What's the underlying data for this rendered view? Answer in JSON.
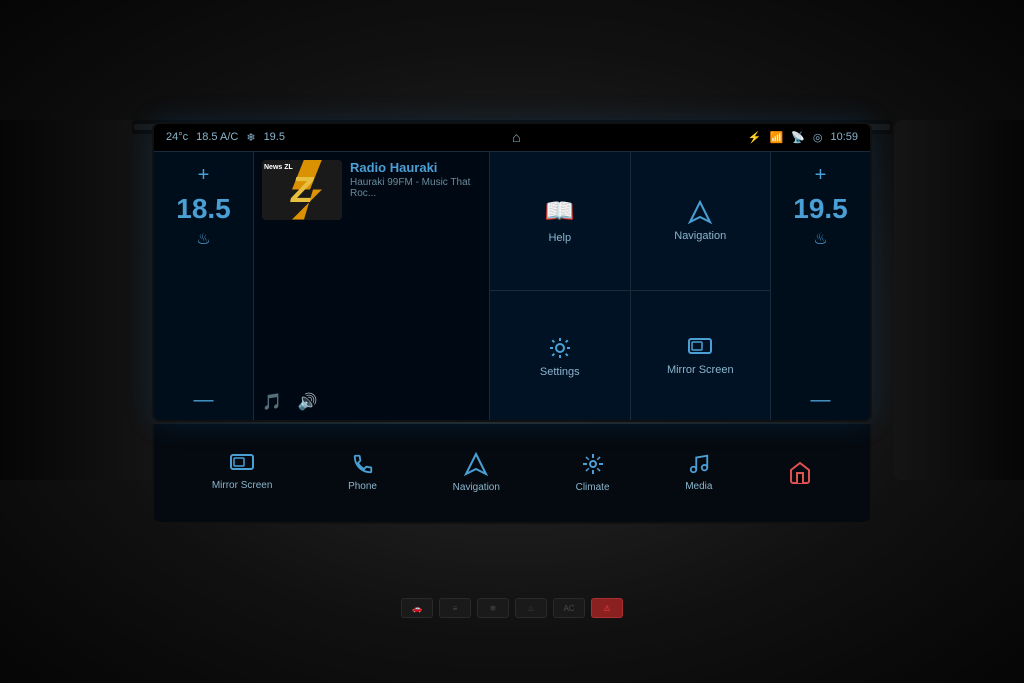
{
  "statusBar": {
    "tempLeft": "24°c",
    "acTemp": "18.5 A/C",
    "fanSpeed": "19.5",
    "time": "10:59",
    "homeIcon": "⌂"
  },
  "climateLeft": {
    "plusLabel": "+",
    "temperature": "18.5",
    "seatIcon": "♨",
    "minusLabel": "—"
  },
  "climateRight": {
    "plusLabel": "+",
    "temperature": "19.5",
    "seatIcon": "♨",
    "minusLabel": "—"
  },
  "media": {
    "stationName": "Radio Hauraki",
    "stationSubtitle": "Hauraki 99FM - Music That Roc...",
    "logoText": "Z",
    "newsLabel": "News ZL"
  },
  "apps": [
    {
      "id": "help",
      "label": "Help",
      "icon": "book"
    },
    {
      "id": "navigation",
      "label": "Navigation",
      "icon": "triangle"
    },
    {
      "id": "settings",
      "label": "Settings",
      "icon": "gear"
    },
    {
      "id": "mirror-screen",
      "label": "Mirror Screen",
      "icon": "mirror"
    }
  ],
  "bottomBar": {
    "buttons": [
      {
        "id": "mirror-screen",
        "label": "Mirror Screen",
        "icon": "📱"
      },
      {
        "id": "phone",
        "label": "Phone",
        "icon": "📞"
      },
      {
        "id": "navigation",
        "label": "Navigation",
        "icon": "nav"
      },
      {
        "id": "climate",
        "label": "Climate",
        "icon": "❄"
      },
      {
        "id": "media",
        "label": "Media",
        "icon": "♪"
      },
      {
        "id": "home",
        "label": "",
        "icon": "⌂",
        "isHome": true
      }
    ]
  },
  "colors": {
    "accent": "#4a9fd4",
    "background": "#000814",
    "text": "#8ab4cc",
    "homeRed": "#e05050"
  }
}
